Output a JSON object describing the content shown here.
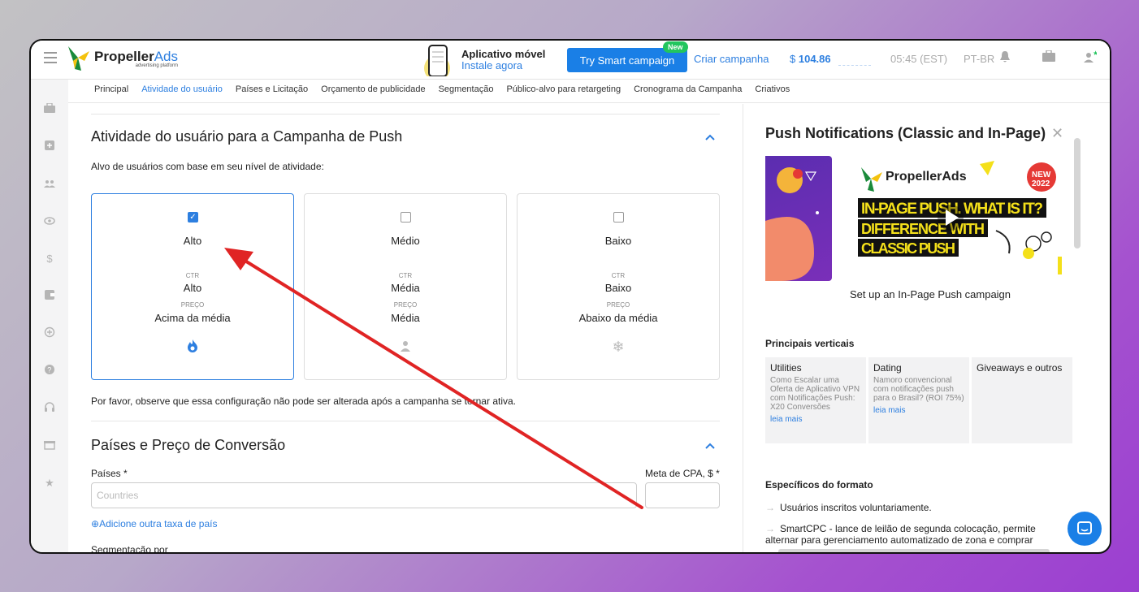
{
  "header": {
    "logo_name": "Propeller",
    "logo_ads": "Ads",
    "logo_sub": "advertising platform",
    "promo_title": "Aplicativo móvel",
    "promo_link": "Instale agora",
    "smart_btn": "Try Smart campaign",
    "new_badge": "New",
    "criar": "Criar campanha",
    "balance_currency": "$",
    "balance_value": "104.86",
    "time": "05:45 (EST)",
    "lang": "PT-BR"
  },
  "nav": {
    "tabs": [
      "Principal",
      "Atividade do usuário",
      "Países e Licitação",
      "Orçamento de publicidade",
      "Segmentação",
      "Público-alvo para retargeting",
      "Cronograma da Campanha",
      "Criativos"
    ]
  },
  "activity": {
    "title": "Atividade do usuário para a Campanha de Push",
    "subtitle": "Alvo de usuários com base em seu nível de atividade:",
    "ctr_label": "CTR",
    "price_label": "PREÇO",
    "cards": [
      {
        "level": "Alto",
        "ctr": "Alto",
        "price": "Acima da média",
        "checked": true
      },
      {
        "level": "Médio",
        "ctr": "Média",
        "price": "Média",
        "checked": false
      },
      {
        "level": "Baixo",
        "ctr": "Baixo",
        "price": "Abaixo da média",
        "checked": false
      }
    ],
    "note": "Por favor, observe que essa configuração não pode ser alterada após a campanha se tornar ativa."
  },
  "countries": {
    "title": "Países e Preço de Conversão",
    "countries_label": "Países *",
    "countries_placeholder": "Countries",
    "cpa_label": "Meta de CPA, $ *",
    "add_link": "Adicione outra taxa de país",
    "segmentation": "Segmentação por"
  },
  "right_panel": {
    "title": "Push Notifications (Classic and In-Page)",
    "video_brand": "PropellerAds",
    "video_badge_1": "NEW",
    "video_badge_2": "2022",
    "video_line_1": "IN-PAGE PUSH. WHAT IS IT?",
    "video_line_2": "DIFFERENCE WITH",
    "video_line_3": "CLASSIC PUSH",
    "video_caption": "Set up an In-Page Push campaign",
    "verticals_heading": "Principais verticais",
    "verticals": [
      {
        "title": "Utilities",
        "desc": "Como Escalar uma Oferta de Aplicativo VPN com Notificações Push: X20 Conversões",
        "link": "leia mais"
      },
      {
        "title": "Dating",
        "desc": "Namoro convencional com notificações push para o Brasil? (ROI 75%)",
        "link": "leia mais"
      },
      {
        "title": "Giveaways e outros",
        "desc": "",
        "link": ""
      }
    ],
    "format_heading": "Específicos do formato",
    "bullets": [
      "Usuários inscritos voluntariamente.",
      "SmartCPC - lance de leilão de segunda colocação, permite alternar para gerenciamento automatizado de zona e comprar"
    ]
  },
  "colors": {
    "accent": "#2d7fe0",
    "annotation_arrow": "#e02424",
    "new_badge": "#22c55e"
  }
}
